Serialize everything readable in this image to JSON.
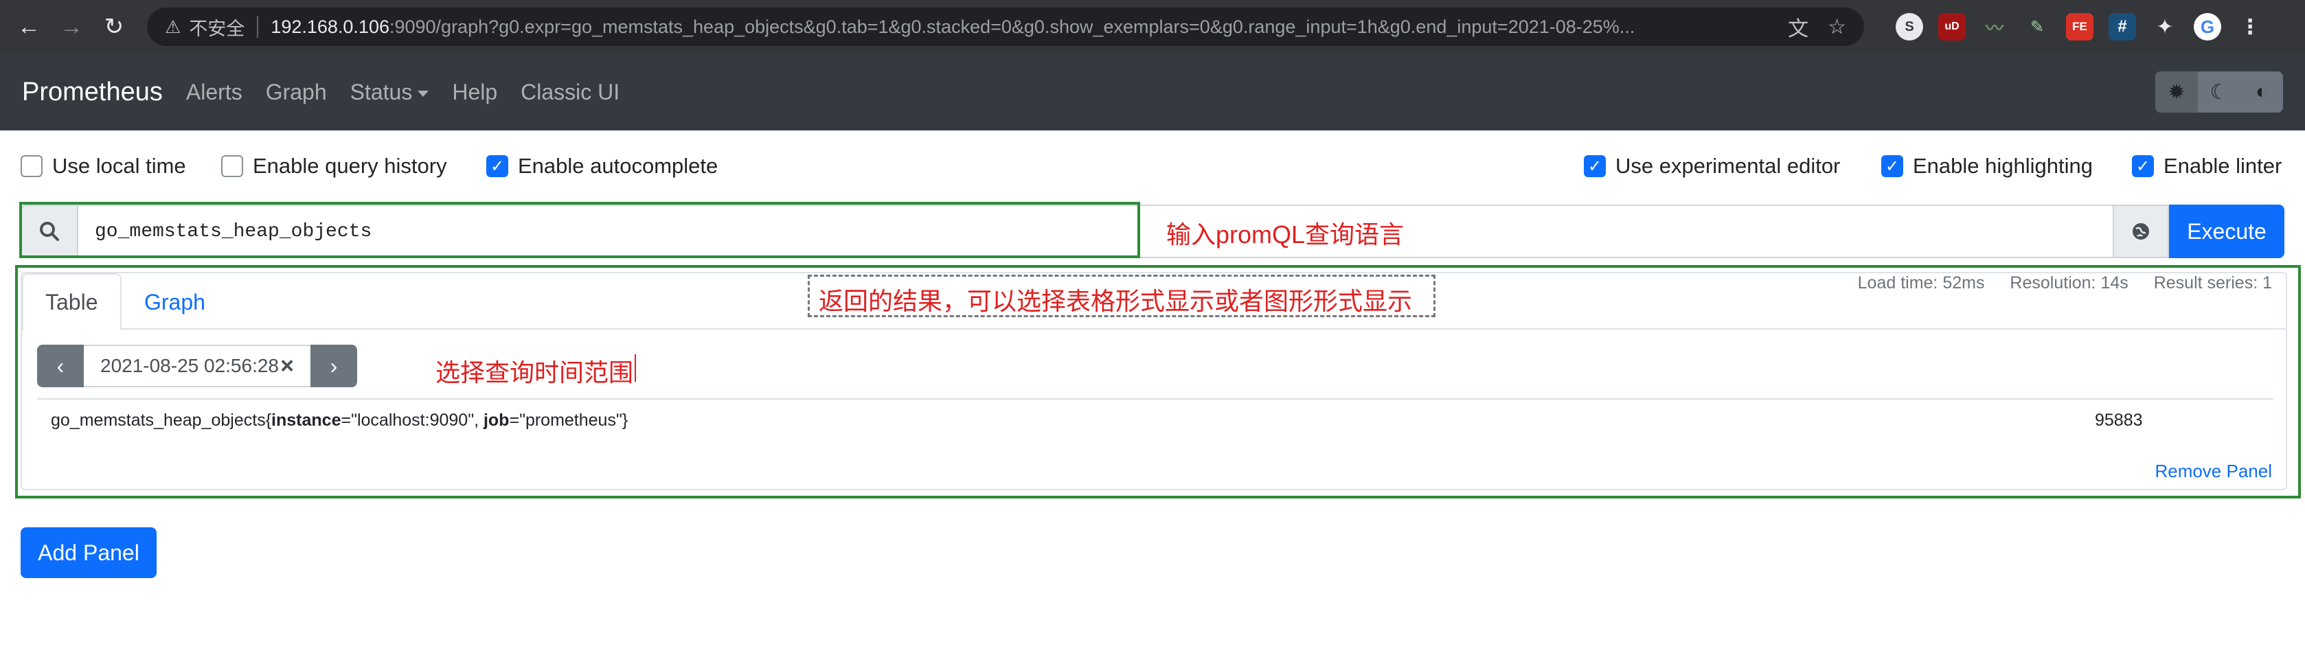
{
  "browser": {
    "insecure_label": "不安全",
    "url_host": "192.168.0.106",
    "url_rest": ":9090/graph?g0.expr=go_memstats_heap_objects&g0.tab=1&g0.stacked=0&g0.show_exemplars=0&g0.range_input=1h&g0.end_input=2021-08-25%...",
    "extensions": [
      {
        "icon": "ext-s-icon",
        "label": "S",
        "color": "#3c4043"
      },
      {
        "icon": "ublock-icon",
        "label": "uD",
        "color": "#a31515"
      },
      {
        "icon": "ext-chart-icon",
        "label": "",
        "color": "#35363a"
      },
      {
        "icon": "ext-pin-icon",
        "label": "",
        "color": "#35363a"
      },
      {
        "icon": "fe-helper-icon",
        "label": "FE",
        "color": "#d93025"
      },
      {
        "icon": "hash-icon",
        "label": "#",
        "color": "#1a3a5a"
      }
    ]
  },
  "navbar": {
    "brand": "Prometheus",
    "links": [
      "Alerts",
      "Graph",
      "Status",
      "Help",
      "Classic UI"
    ]
  },
  "options": {
    "left": [
      {
        "label": "Use local time",
        "checked": false
      },
      {
        "label": "Enable query history",
        "checked": false
      },
      {
        "label": "Enable autocomplete",
        "checked": true
      }
    ],
    "right": [
      {
        "label": "Use experimental editor",
        "checked": true
      },
      {
        "label": "Enable highlighting",
        "checked": true
      },
      {
        "label": "Enable linter",
        "checked": true
      }
    ]
  },
  "query": {
    "expression": "go_memstats_heap_objects",
    "execute_label": "Execute"
  },
  "annotations": {
    "query_note": "输入promQL查询语言",
    "result_note": "返回的结果，可以选择表格形式显示或者图形形式显示",
    "time_note": "选择查询时间范围"
  },
  "panel": {
    "tabs": [
      "Table",
      "Graph"
    ],
    "stats": {
      "load_time": "Load time: 52ms",
      "resolution": "Resolution: 14s",
      "result_series": "Result series: 1"
    },
    "eval_time": "2021-08-25 02:56:28",
    "result": {
      "metric_name": "go_memstats_heap_objects{",
      "label1_key": "instance",
      "label1_value": "=\"localhost:9090\", ",
      "label2_key": "job",
      "label2_value": "=\"prometheus\"}",
      "value": "95883"
    },
    "remove_label": "Remove Panel"
  },
  "add_panel_label": "Add Panel"
}
